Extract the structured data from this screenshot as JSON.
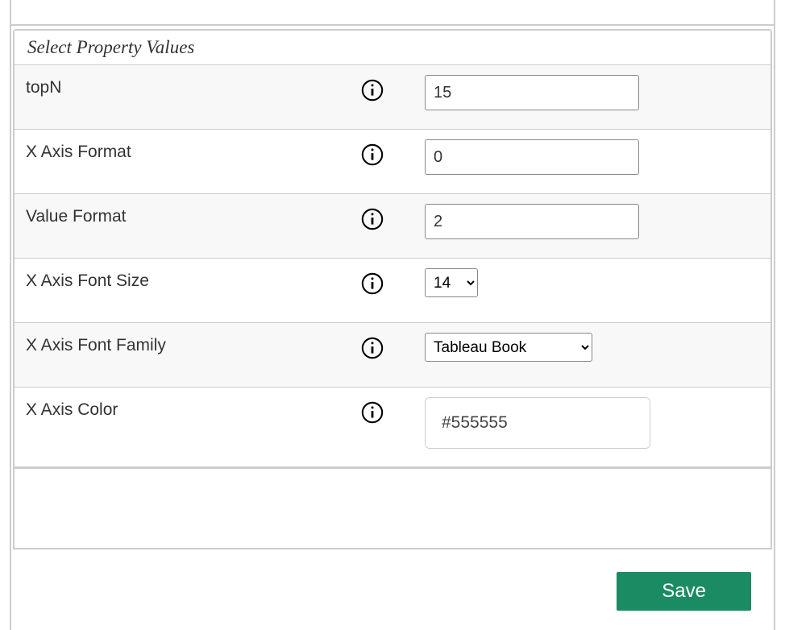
{
  "section_title": "Select Property Values",
  "rows": {
    "topN": {
      "label": "topN",
      "value": "15"
    },
    "xAxisFormat": {
      "label": "X Axis Format",
      "value": "0"
    },
    "valueFormat": {
      "label": "Value Format",
      "value": "2"
    },
    "xAxisFontSize": {
      "label": "X Axis Font Size",
      "value": "14"
    },
    "xAxisFontFamily": {
      "label": "X Axis Font Family",
      "value": "Tableau Book"
    },
    "xAxisColor": {
      "label": "X Axis Color",
      "value": "#555555",
      "swatch": "#555555"
    }
  },
  "footer": {
    "save_label": "Save"
  }
}
